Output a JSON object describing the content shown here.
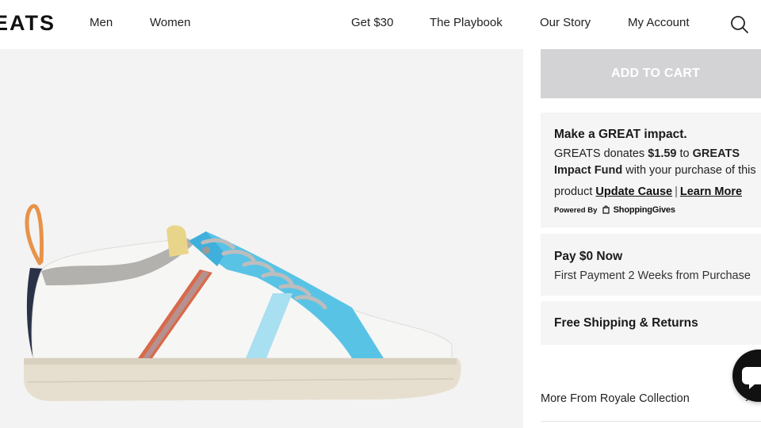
{
  "header": {
    "logo": "EATS",
    "nav_left": [
      "Men",
      "Women"
    ],
    "nav_right": [
      "Get $30",
      "The Playbook",
      "Our Story",
      "My Account"
    ],
    "search_icon": "search-icon"
  },
  "gallery": {
    "background": "#f3f3f3",
    "product_image": "sneaker-side-view"
  },
  "purchase": {
    "add_to_cart": "ADD TO CART",
    "button_color": "#d3d3d6"
  },
  "impact": {
    "title": "Make a GREAT impact.",
    "line1_pre": "GREATS donates ",
    "amount": "$1.59",
    "line1_mid": " to ",
    "fund_part1": "GREATS",
    "fund_part2": "Impact Fund",
    "line2_post": " with your purchase of this",
    "line3_pre": "product ",
    "update_link": "Update Cause",
    "separator": "|",
    "learn_link": "Learn More",
    "powered_by": "Powered By",
    "provider": "ShoppingGives"
  },
  "payment": {
    "title": "Pay $0 Now",
    "subtitle": "First Payment 2 Weeks from Purchase"
  },
  "shipping": {
    "title": "Free Shipping & Returns"
  },
  "collection": {
    "label": "More From Royale Collection",
    "chevron_icon": "chevron-right-icon"
  },
  "chat": {
    "icon": "chat-icon",
    "color": "#111111"
  }
}
